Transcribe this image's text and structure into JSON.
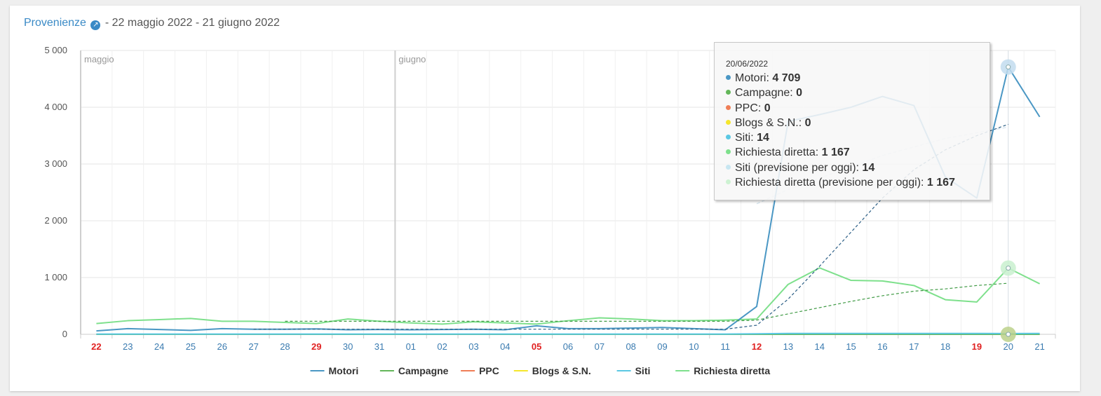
{
  "header": {
    "link_text": "Provenienze",
    "link_icon": "external-link-icon",
    "link_glyph": "↗",
    "date_range": "- 22 maggio 2022 - 21 giugno 2022"
  },
  "chart_data": {
    "type": "line",
    "categories": [
      "22",
      "23",
      "24",
      "25",
      "26",
      "27",
      "28",
      "29",
      "30",
      "31",
      "01",
      "02",
      "03",
      "04",
      "05",
      "06",
      "07",
      "08",
      "09",
      "10",
      "11",
      "12",
      "13",
      "14",
      "15",
      "16",
      "17",
      "18",
      "19",
      "20",
      "21"
    ],
    "weekend_categories": [
      "22",
      "29",
      "05",
      "12",
      "19"
    ],
    "weekend_color": "#e02020",
    "category_color": "#3a7bb0",
    "month_labels": [
      {
        "label": "maggio",
        "at": "22"
      },
      {
        "label": "giugno",
        "at": "01"
      }
    ],
    "ylim": [
      0,
      5000
    ],
    "yticks": [
      0,
      1000,
      2000,
      3000,
      4000,
      5000
    ],
    "ytick_labels": [
      "0",
      "1 000",
      "2 000",
      "3 000",
      "4 000",
      "5 000"
    ],
    "grid": true,
    "legend_position": "bottom-center",
    "series": [
      {
        "name": "Motori",
        "color": "#4a97c4",
        "values": [
          60,
          100,
          85,
          70,
          100,
          90,
          90,
          95,
          80,
          85,
          80,
          85,
          90,
          80,
          150,
          100,
          100,
          110,
          120,
          100,
          80,
          490,
          3750,
          3870,
          4000,
          4190,
          4030,
          2770,
          2400,
          4709,
          3830
        ]
      },
      {
        "name": "Campagne",
        "color": "#63b659",
        "values": [
          0,
          0,
          0,
          0,
          0,
          0,
          0,
          0,
          0,
          0,
          0,
          0,
          0,
          0,
          0,
          0,
          0,
          0,
          0,
          0,
          0,
          0,
          0,
          0,
          0,
          0,
          0,
          0,
          0,
          0,
          0
        ]
      },
      {
        "name": "PPC",
        "color": "#ef7e56",
        "values": [
          0,
          0,
          0,
          0,
          0,
          0,
          0,
          0,
          0,
          0,
          0,
          0,
          0,
          0,
          0,
          0,
          0,
          0,
          0,
          0,
          0,
          0,
          0,
          0,
          0,
          0,
          0,
          0,
          0,
          0,
          0
        ]
      },
      {
        "name": "Blogs & S.N.",
        "color": "#f5e62c",
        "values": [
          0,
          0,
          0,
          0,
          0,
          0,
          0,
          0,
          0,
          0,
          0,
          0,
          0,
          0,
          0,
          0,
          0,
          0,
          0,
          0,
          0,
          0,
          0,
          0,
          0,
          0,
          0,
          0,
          0,
          0,
          0
        ]
      },
      {
        "name": "Siti",
        "color": "#5bc8e3",
        "values": [
          5,
          5,
          5,
          5,
          5,
          5,
          5,
          5,
          5,
          5,
          5,
          5,
          5,
          5,
          5,
          5,
          5,
          5,
          5,
          5,
          5,
          10,
          15,
          15,
          15,
          15,
          15,
          15,
          15,
          14,
          15
        ]
      },
      {
        "name": "Richiesta diretta",
        "color": "#7ee08c",
        "values": [
          190,
          240,
          260,
          280,
          230,
          230,
          210,
          190,
          270,
          230,
          200,
          180,
          220,
          200,
          180,
          240,
          290,
          270,
          240,
          240,
          250,
          270,
          880,
          1170,
          950,
          940,
          860,
          610,
          570,
          1167,
          890
        ]
      }
    ],
    "trend_lines": [
      {
        "series": "Motori",
        "color": "#2c5f86",
        "x": [
          "27",
          "28",
          "29",
          "30",
          "31",
          "01",
          "02",
          "03",
          "04",
          "05",
          "06",
          "07",
          "08",
          "09",
          "10",
          "11",
          "12",
          "13",
          "14",
          "15",
          "16",
          "17",
          "18",
          "19",
          "20"
        ],
        "values": [
          90,
          90,
          90,
          90,
          90,
          90,
          90,
          90,
          90,
          90,
          90,
          90,
          90,
          90,
          90,
          90,
          160,
          620,
          1200,
          1800,
          2400,
          2900,
          3250,
          3500,
          3700
        ]
      },
      {
        "series": "Richiesta diretta",
        "color": "#3f9a44",
        "x": [
          "28",
          "29",
          "30",
          "31",
          "01",
          "02",
          "03",
          "04",
          "05",
          "06",
          "07",
          "08",
          "09",
          "10",
          "11",
          "12",
          "13",
          "14",
          "15",
          "16",
          "17",
          "18",
          "19",
          "20"
        ],
        "values": [
          230,
          230,
          230,
          230,
          230,
          230,
          230,
          230,
          230,
          230,
          230,
          230,
          230,
          230,
          230,
          250,
          360,
          470,
          580,
          680,
          760,
          800,
          860,
          900
        ]
      }
    ],
    "forecast_line": {
      "series": "Siti",
      "color": "#d8e6ef",
      "x": [
        "12",
        "13",
        "14",
        "15",
        "16",
        "17",
        "18",
        "19",
        "20"
      ],
      "values": [
        2300,
        2550,
        2750,
        2950,
        3150,
        3300,
        3450,
        3550,
        3650
      ]
    },
    "highlight": {
      "x": "20",
      "markers": [
        {
          "series": "Motori",
          "value": 4709,
          "color": "#c2dcef"
        },
        {
          "series": "Richiesta diretta",
          "value": 1167,
          "color": "#c9f0cf"
        },
        {
          "series": "Campagne",
          "value": 0,
          "color": "#bcd18b"
        }
      ]
    }
  },
  "tooltip": {
    "date": "20/06/2022",
    "rows": [
      {
        "label": "Motori: ",
        "value": "4 709",
        "color": "#4a97c4"
      },
      {
        "label": "Campagne: ",
        "value": "0",
        "color": "#63b659"
      },
      {
        "label": "PPC: ",
        "value": "0",
        "color": "#ef7e56"
      },
      {
        "label": "Blogs & S.N.: ",
        "value": "0",
        "color": "#f5e62c"
      },
      {
        "label": "Siti: ",
        "value": "14",
        "color": "#5bc8e3"
      },
      {
        "label": "Richiesta diretta: ",
        "value": "1 167",
        "color": "#7ee08c"
      },
      {
        "label": "Siti (previsione per oggi): ",
        "value": "14",
        "color": "#c7e6f1"
      },
      {
        "label": "Richiesta diretta (previsione per oggi): ",
        "value": "1 167",
        "color": "#cdf2d2"
      }
    ]
  }
}
